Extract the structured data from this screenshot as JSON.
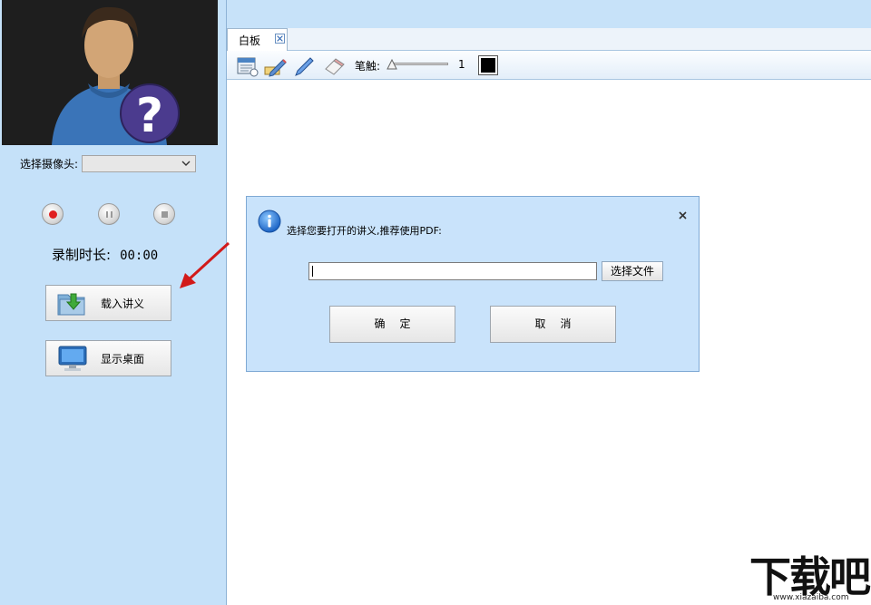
{
  "left_panel": {
    "camera_label": "选择摄像头:",
    "camera_selected": "",
    "duration_label": "录制时长:",
    "duration_value": "00:00",
    "load_lecture_label": "载入讲义",
    "show_desktop_label": "显示桌面"
  },
  "tabs": [
    {
      "label": "白板"
    }
  ],
  "toolbar": {
    "pen_label": "笔触:",
    "pen_size": "1",
    "pen_color": "#000000"
  },
  "dialog": {
    "prompt": "选择您要打开的讲义,推荐使用PDF:",
    "path_value": "",
    "browse_label": "选择文件",
    "ok_label": "确定",
    "cancel_label": "取消"
  },
  "watermark": {
    "text": "下载吧",
    "url": "www.xiazaiba.com"
  }
}
